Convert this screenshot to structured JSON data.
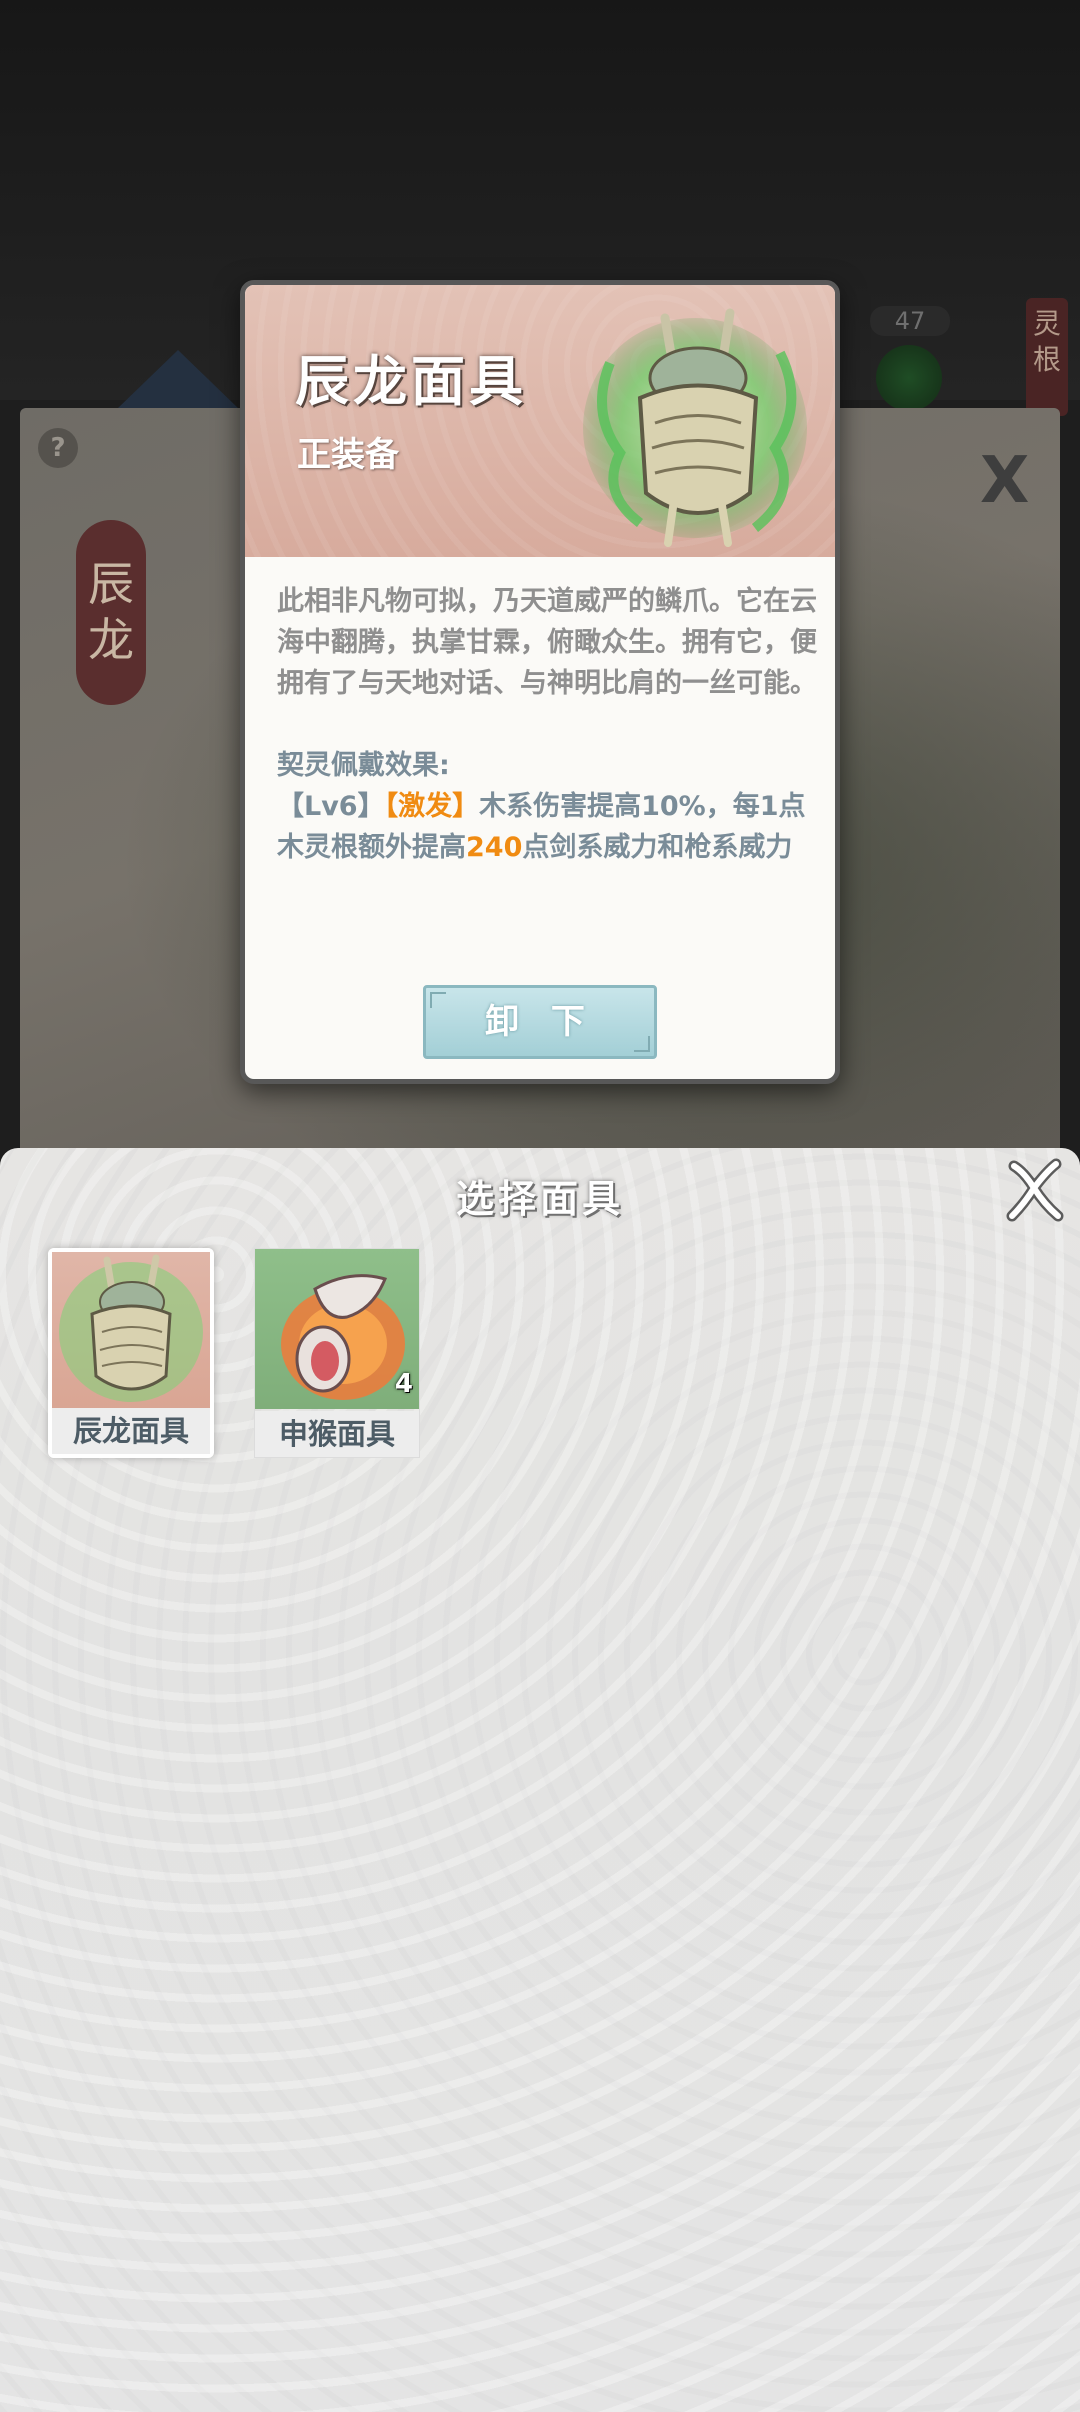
{
  "background": {
    "help_symbol": "?",
    "ribbon_chars": [
      "辰",
      "龙"
    ],
    "close_symbol": "X",
    "counter": "47",
    "side_tab_chars": [
      "灵",
      "根"
    ]
  },
  "popup": {
    "title": "辰龙面具",
    "status": "正装备",
    "description": "此相非凡物可拟，乃天道威严的鳞爪。它在云海中翻腾，执掌甘霖，俯瞰众生。拥有它，便拥有了与天地对话、与神明比肩的一丝可能。",
    "effect_title": "契灵佩戴效果:",
    "effect_level": "【Lv6】",
    "effect_tag": "【激发】",
    "effect_text_a": "木系伤害提高10%，每1点木灵根额外提高",
    "effect_value": "240",
    "effect_text_b": "点剑系威力和枪系威力",
    "button_label": "卸 下"
  },
  "sheet": {
    "title": "选择面具",
    "items": [
      {
        "name": "辰龙面具",
        "count": "",
        "selected": true,
        "icon": "dragon-mask-icon"
      },
      {
        "name": "申猴面具",
        "count": "4",
        "selected": false,
        "icon": "monkey-mask-icon"
      }
    ]
  },
  "colors": {
    "accent_orange": "#f08b12",
    "effect_blue": "#7a8c98",
    "button_cyan": "#a3cfd6"
  }
}
